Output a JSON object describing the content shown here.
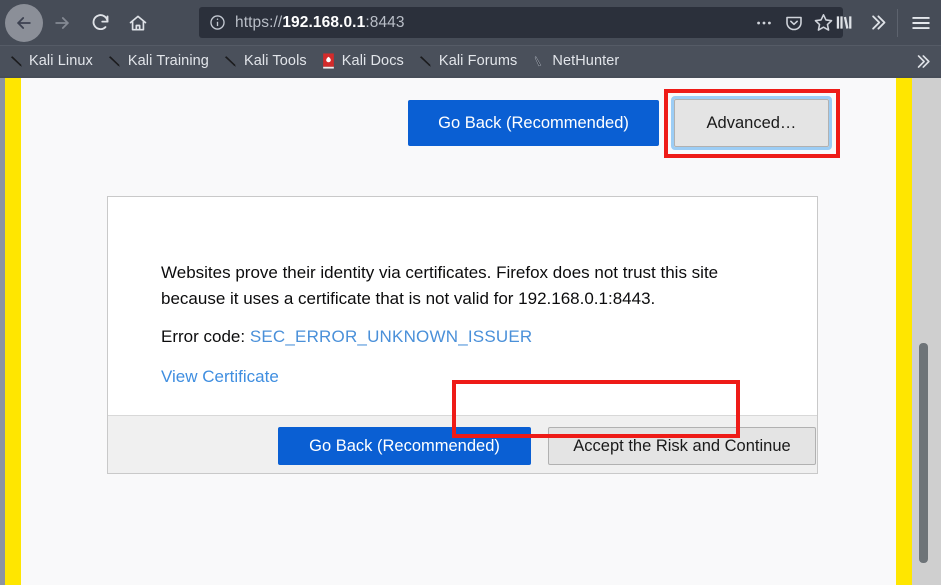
{
  "browser": {
    "nav": {
      "back": "back-arrow-icon",
      "forward": "forward-arrow-icon",
      "reload": "reload-icon",
      "home": "home-icon"
    },
    "urlbar": {
      "identity_icon": "info-circle-icon",
      "scheme": "https://",
      "host": "192.168.0.1",
      "port": ":8443",
      "full_url": "https://192.168.0.1:8443",
      "actions": [
        "page-actions-ellipsis-icon",
        "pocket-icon",
        "bookmark-star-icon"
      ]
    },
    "toolbar_right": [
      "library-icon",
      "overflow-chevrons-icon",
      "hamburger-menu-icon"
    ],
    "bookmarks": [
      {
        "label": "Kali Linux",
        "icon": "kali-dragon-icon"
      },
      {
        "label": "Kali Training",
        "icon": "kali-dragon-icon"
      },
      {
        "label": "Kali Tools",
        "icon": "kali-dragon-icon"
      },
      {
        "label": "Kali Docs",
        "icon": "kali-docs-book-icon"
      },
      {
        "label": "Kali Forums",
        "icon": "kali-dragon-icon"
      },
      {
        "label": "NetHunter",
        "icon": "nethunter-icon"
      }
    ],
    "bookmarks_overflow": "bookmarks-overflow-chevrons-icon"
  },
  "page": {
    "top_actions": {
      "go_back_label": "Go Back (Recommended)",
      "advanced_label": "Advanced…"
    },
    "panel": {
      "body_text": "Websites prove their identity via certificates. Firefox does not trust this site because it uses a certificate that is not valid for 192.168.0.1:8443.",
      "error_label": "Error code:",
      "error_code": "SEC_ERROR_UNKNOWN_ISSUER",
      "view_certificate_label": "View Certificate",
      "footer": {
        "go_back_label": "Go Back (Recommended)",
        "accept_label": "Accept the Risk and Continue"
      }
    }
  },
  "annotations": {
    "highlight_color": "#ee1b17",
    "frame_color": "#ffe600",
    "boxes": [
      "advanced-button-highlight",
      "accept-the-risk-button-highlight"
    ]
  },
  "colors": {
    "chrome_bg": "#464c57",
    "urlbar_bg": "#2b303b",
    "primary_button": "#0a5fd3",
    "link": "#3f8ee0",
    "page_bg": "#f9f9fa"
  }
}
